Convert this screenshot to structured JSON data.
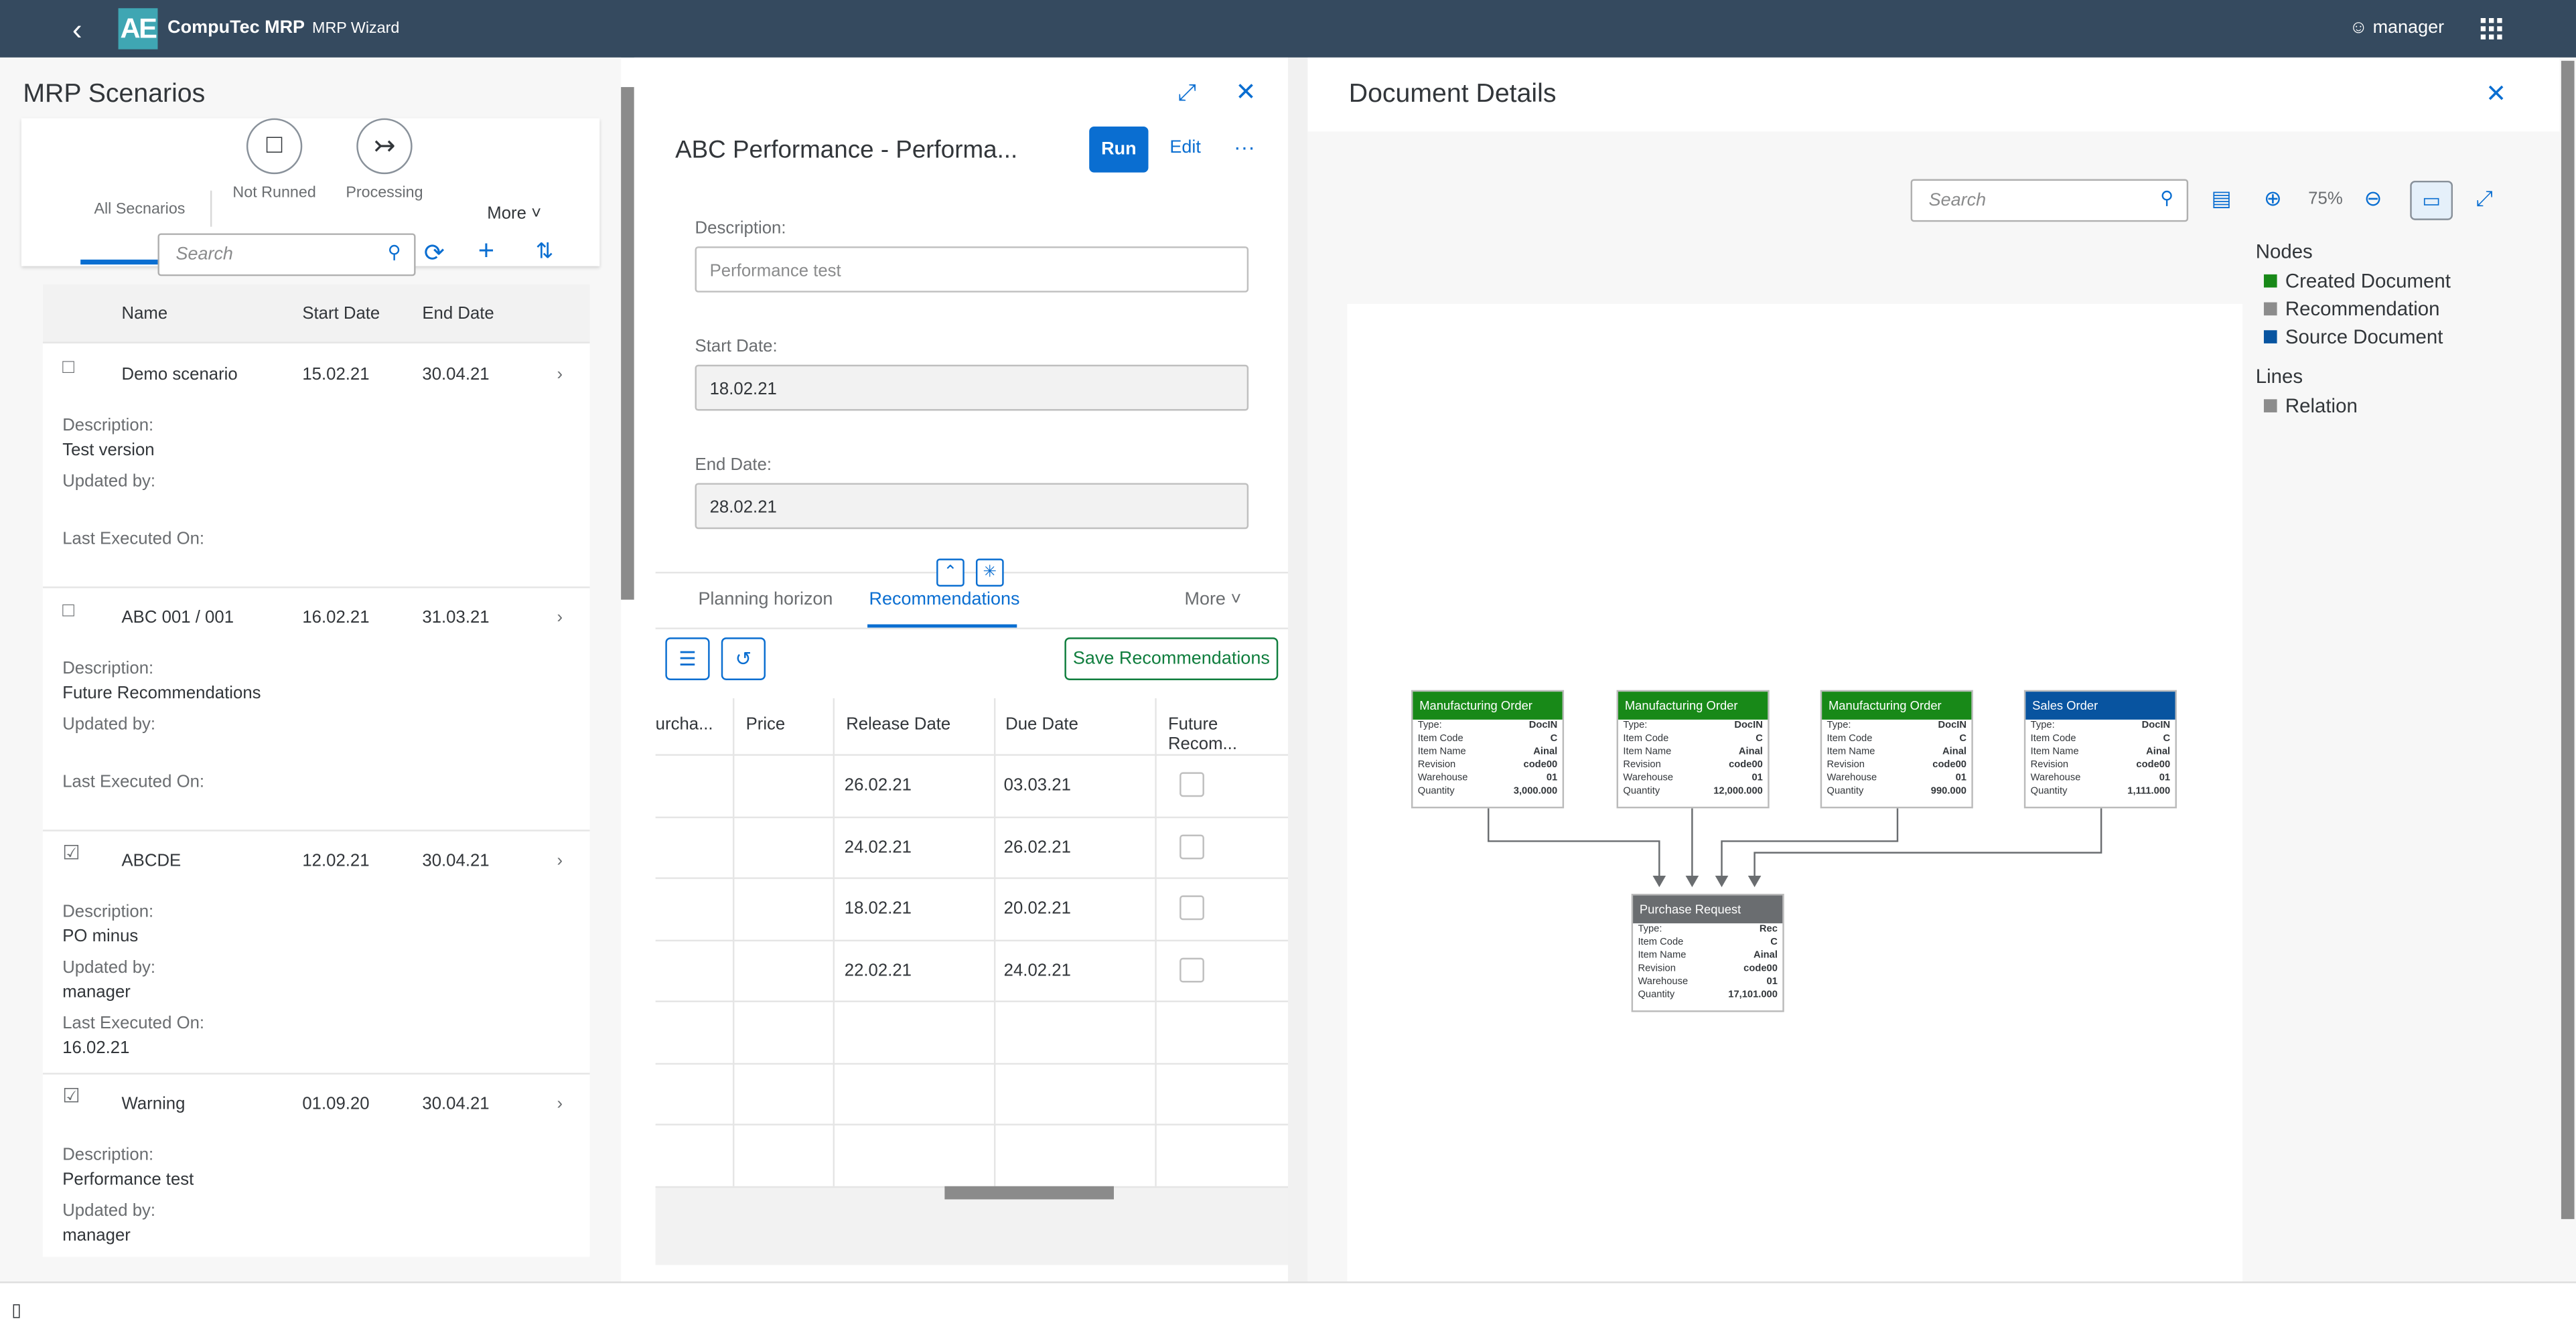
{
  "shell": {
    "logo_text": "AE",
    "app_name": "CompuTec MRP",
    "subtitle": "MRP Wizard",
    "user": "manager"
  },
  "left": {
    "title": "MRP Scenarios",
    "filters": [
      {
        "label": "All Secnarios"
      },
      {
        "label": "Not Runned"
      },
      {
        "label": "Processing"
      }
    ],
    "more": "More",
    "search_placeholder": "Search",
    "columns": {
      "name": "Name",
      "start": "Start Date",
      "end": "End Date"
    },
    "labels": {
      "description": "Description:",
      "updated_by": "Updated by:",
      "last_executed": "Last Executed On:"
    },
    "rows": [
      {
        "name": "Demo scenario",
        "start": "15.02.21",
        "end": "30.04.21",
        "description": "Test version",
        "updated_by": "",
        "last_executed": ""
      },
      {
        "name": "ABC 001 / 001",
        "start": "16.02.21",
        "end": "31.03.21",
        "description": "Future Recommendations",
        "updated_by": "",
        "last_executed": ""
      },
      {
        "name": "ABCDE",
        "start": "12.02.21",
        "end": "30.04.21",
        "description": "PO minus",
        "updated_by": "manager",
        "last_executed": "16.02.21"
      },
      {
        "name": "Warning",
        "start": "01.09.20",
        "end": "30.04.21",
        "description": "Performance test",
        "updated_by": "manager",
        "last_executed": ""
      }
    ]
  },
  "mid": {
    "title": "ABC Performance - Performa...",
    "run": "Run",
    "edit": "Edit",
    "desc_label": "Description:",
    "desc_placeholder": "Performance test",
    "start_label": "Start Date:",
    "start_value": "18.02.21",
    "end_label": "End Date:",
    "end_value": "28.02.21",
    "tabs": [
      "Planning horizon",
      "Recommendations"
    ],
    "more": "More",
    "save": "Save Recommendations",
    "columns": [
      "urcha...",
      "Price",
      "Release Date",
      "Due Date",
      "Future Recom..."
    ],
    "rows": [
      {
        "release": "26.02.21",
        "due": "03.03.21"
      },
      {
        "release": "24.02.21",
        "due": "26.02.21"
      },
      {
        "release": "18.02.21",
        "due": "20.02.21"
      },
      {
        "release": "22.02.21",
        "due": "24.02.21"
      }
    ]
  },
  "right": {
    "title": "Document Details",
    "search_placeholder": "Search",
    "zoom": "75%",
    "legend": {
      "nodes_title": "Nodes",
      "lines_title": "Lines",
      "items": [
        {
          "label": "Created Document",
          "color": "#188918"
        },
        {
          "label": "Recommendation",
          "color": "#8c8c8c"
        },
        {
          "label": "Source Document",
          "color": "#0854a0"
        }
      ],
      "line_item": "Relation"
    },
    "field_labels": {
      "type": "Type:",
      "item": "Item Code",
      "name": "Item Name",
      "rev": "Revision",
      "wh": "Warehouse",
      "qty": "Quantity"
    },
    "nodes": [
      {
        "title": "Manufacturing Order",
        "color": "#188918",
        "type": "DocIN",
        "item": "C",
        "name": "Ainal",
        "rev": "code00",
        "wh": "01",
        "qty": "3,000.000"
      },
      {
        "title": "Manufacturing Order",
        "color": "#188918",
        "type": "DocIN",
        "item": "C",
        "name": "Ainal",
        "rev": "code00",
        "wh": "01",
        "qty": "12,000.000"
      },
      {
        "title": "Manufacturing Order",
        "color": "#188918",
        "type": "DocIN",
        "item": "C",
        "name": "Ainal",
        "rev": "code00",
        "wh": "01",
        "qty": "990.000"
      },
      {
        "title": "Sales Order",
        "color": "#0854a0",
        "type": "DocIN",
        "item": "C",
        "name": "Ainal",
        "rev": "code00",
        "wh": "01",
        "qty": "1,111.000"
      },
      {
        "title": "Purchase Request",
        "color": "#6a6d70",
        "type": "Rec",
        "item": "C",
        "name": "Ainal",
        "rev": "code00",
        "wh": "01",
        "qty": "17,101.000"
      }
    ]
  }
}
